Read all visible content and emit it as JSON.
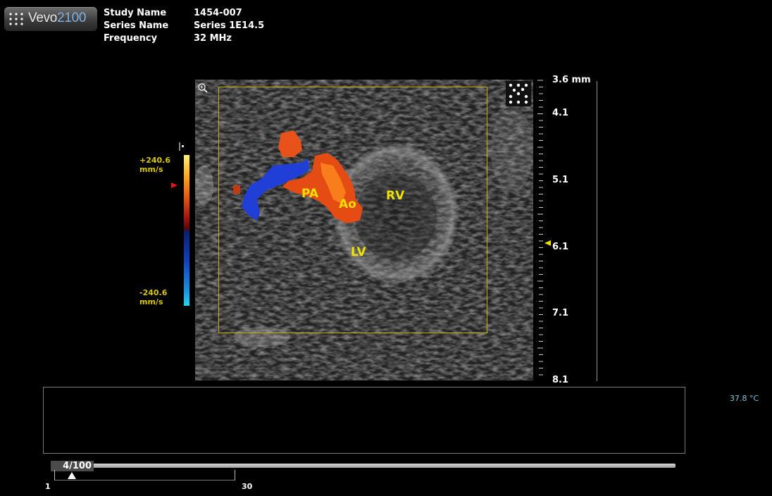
{
  "logo": {
    "brand_name": "Vevo",
    "model_number": "2100"
  },
  "study_info": [
    {
      "label": "Study Name",
      "value": "1454-007"
    },
    {
      "label": "Series Name",
      "value": "Series 1E14.5"
    },
    {
      "label": "Frequency",
      "value": "32 MHz"
    }
  ],
  "annotations": {
    "pa": "PA",
    "ao": "Ao",
    "rv": "RV",
    "lv": "LV"
  },
  "color_scale": {
    "max_value": "+240.6",
    "max_unit": "mm/s",
    "min_value": "-240.6",
    "min_unit": "mm/s",
    "positive_colors": [
      "#fff27a",
      "#ffb020",
      "#e85a10",
      "#a01010"
    ],
    "negative_colors": [
      "#0a1e6a",
      "#1040c0",
      "#1a90e0",
      "#20d8f0"
    ]
  },
  "depth_ruler": {
    "labels": [
      "3.6 mm",
      "4.1",
      "5.1",
      "6.1",
      "7.1",
      "8.1"
    ],
    "focus_depth": 6.1
  },
  "status": {
    "temperature": "37.8 °C"
  },
  "frame_bar": {
    "frame_label": "4/100",
    "progress": 0.04
  },
  "cine_range": {
    "start": "1",
    "end": "30"
  },
  "colors": {
    "annotation": "#f2e000",
    "roi": "#c8b400",
    "temperature": "#7fc4d8"
  }
}
